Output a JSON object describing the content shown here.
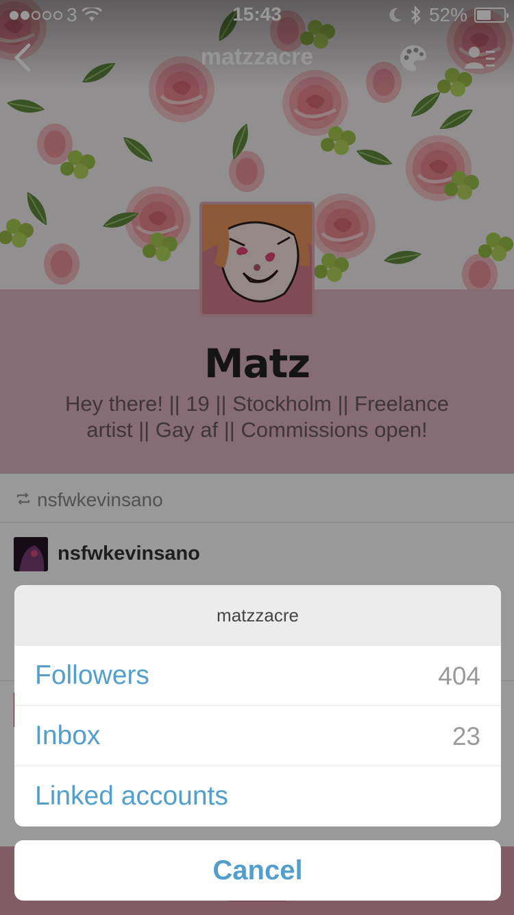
{
  "status_bar": {
    "carrier": "3",
    "signal_dots_filled": 2,
    "signal_dots_total": 5,
    "time": "15:43",
    "battery": "52%",
    "icons": [
      "wifi-icon",
      "moon-icon",
      "bluetooth-icon",
      "battery-icon"
    ]
  },
  "nav": {
    "title": "matzzacre",
    "icons": [
      "back-chevron-icon",
      "palette-icon",
      "follow-list-icon"
    ]
  },
  "profile": {
    "name": "Matz",
    "bio": "Hey there! || 19 || Stockholm || Freelance artist || Gay af || Commissions open!"
  },
  "post": {
    "reblogged_from": "nsfwkevinsano",
    "author": "nsfwkevinsano"
  },
  "action_sheet": {
    "title": "matzzacre",
    "items": [
      {
        "label": "Followers",
        "count": "404"
      },
      {
        "label": "Inbox",
        "count": "23"
      },
      {
        "label": "Linked accounts",
        "count": ""
      }
    ],
    "cancel_label": "Cancel"
  },
  "colors": {
    "accent": "#529ecc",
    "profile_bg": "#dfb5c2",
    "sheet_title_bg": "#ececec"
  }
}
